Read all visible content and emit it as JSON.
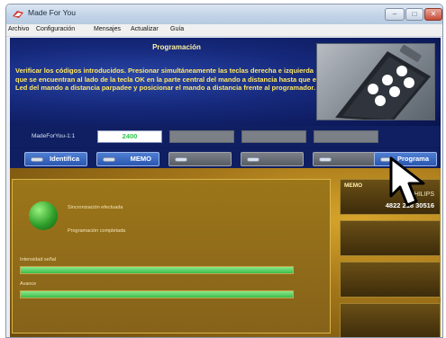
{
  "window": {
    "title": "Made For You",
    "controls": {
      "minimize": "–",
      "maximize": "□",
      "close": "✕"
    }
  },
  "menu": [
    "Archivo",
    "Configuración",
    "Mensajes",
    "Actualizar",
    "Guía"
  ],
  "banner": {
    "title": "Programación",
    "instructions": "Verificar los códigos introducidos. Presionar simultáneamente las teclas derecha e izquierda que se encuentran al lado de la tecla OK en la parte central del mando a distancia hasta que el Led del mando a distancia parpadee y posicionar el mando a distancia frente al programador."
  },
  "id_row": {
    "label": "MadeForYou-1:1",
    "code": "2400"
  },
  "buttons": [
    {
      "label": "Identifica",
      "active": true
    },
    {
      "label": "MEMO",
      "active": true
    },
    {
      "label": "",
      "active": false
    },
    {
      "label": "",
      "active": false
    },
    {
      "label": "",
      "active": false
    },
    {
      "label": "Programa",
      "active": true
    }
  ],
  "status": {
    "sync": "Sincronización efectuada",
    "done": "Programación completada"
  },
  "progress": [
    {
      "label": "Intensidad señal",
      "value": 1.0
    },
    {
      "label": "Avance",
      "value": 1.0
    }
  ],
  "side": {
    "memo": "MEMO",
    "brand": "PHILIPS",
    "code": "4822 218 30516"
  },
  "colors": {
    "accent": "#ffe866",
    "progress": "#3bbb4c",
    "button": "#2a57b0"
  },
  "icons": {
    "app": "app-icon",
    "cursor": "mouse-pointer-icon",
    "orb": "green-status-orb"
  }
}
